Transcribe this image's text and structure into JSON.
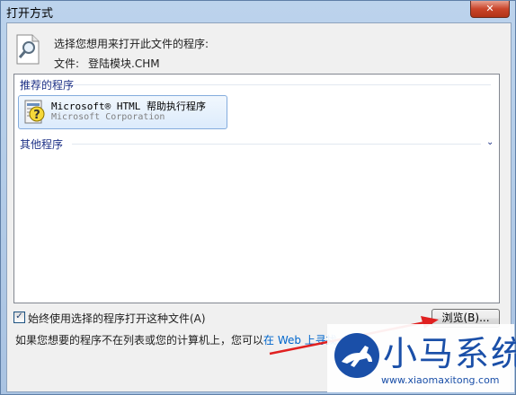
{
  "window": {
    "title": "打开方式",
    "close_label": "✕"
  },
  "header": {
    "prompt": "选择您想用来打开此文件的程序:",
    "file_label": "文件:",
    "file_name": "登陆模块.CHM"
  },
  "list": {
    "recommended_label": "推荐的程序",
    "other_label": "其他程序",
    "expand_glyph": "⌄",
    "items": [
      {
        "name": "Microsoft® HTML 帮助执行程序",
        "vendor": "Microsoft Corporation"
      }
    ]
  },
  "options": {
    "always_use_label": "始终使用选择的程序打开这种文件(A)",
    "always_use_checked": true
  },
  "buttons": {
    "browse_label": "浏览(B)..."
  },
  "footer": {
    "text_prefix": "如果您想要的程序不在列表或您的计算机上，您可以",
    "link_text": "在 Web 上寻找"
  },
  "watermark": {
    "brand": "小马系统",
    "url": "www.xiaomaxitong.com"
  },
  "colors": {
    "arrow": "#e02020",
    "link": "#0066cc",
    "group_header": "#1e3287"
  },
  "icons": {
    "header": "magnifier-document-icon",
    "app": "help-file-icon",
    "close": "close-icon"
  }
}
